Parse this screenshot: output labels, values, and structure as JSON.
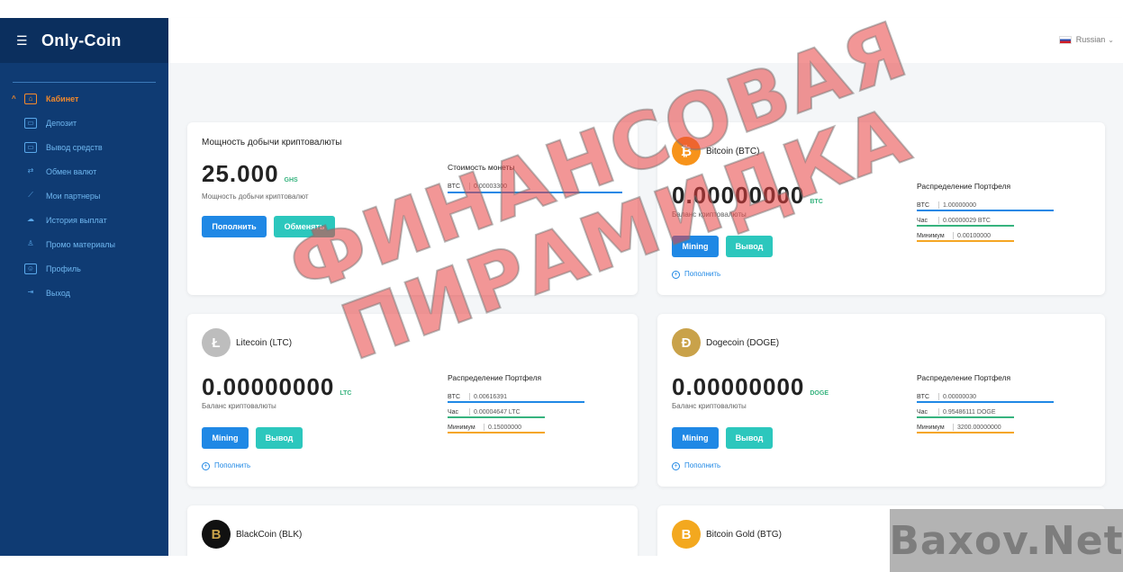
{
  "brand": {
    "menu_icon": "menu-icon",
    "name": "Only-Coin"
  },
  "header": {
    "language": "Russian"
  },
  "sidebar": {
    "items": [
      {
        "label": "Кабинет",
        "icon": "bank-icon",
        "active": true
      },
      {
        "label": "Депозит",
        "icon": "wallet-icon"
      },
      {
        "label": "Вывод средств",
        "icon": "withdraw-icon"
      },
      {
        "label": "Обмен валют",
        "icon": "exchange-icon"
      },
      {
        "label": "Мои партнеры",
        "icon": "chart-icon"
      },
      {
        "label": "История выплат",
        "icon": "history-icon"
      },
      {
        "label": "Промо материалы",
        "icon": "user-icon"
      },
      {
        "label": "Профиль",
        "icon": "profile-icon"
      },
      {
        "label": "Выход",
        "icon": "logout-icon"
      }
    ]
  },
  "power_card": {
    "title": "Мощность добычи криптовалюты",
    "value": "25.000",
    "unit": "GHS",
    "caption": "Мощность добычи криптовалют",
    "topup_label": "Пополнить",
    "exchange_label": "Обменять",
    "price_title": "Стоимость монеты",
    "price_row": {
      "k": "BTC",
      "v": "0.00003300"
    }
  },
  "btc_card": {
    "name": "Bitcoin (BTC)",
    "value": "0.00000000",
    "unit": "BTC",
    "caption": "Баланс криптовалюты",
    "mining_label": "Mining",
    "withdraw_label": "Вывод",
    "add_label": "Пополнить",
    "dist_title": "Распределение Портфеля",
    "rows": [
      {
        "k": "BTC",
        "v": "1.00000000"
      },
      {
        "k": "Час",
        "v": "0.00000029 BTC"
      },
      {
        "k": "Минимум",
        "v": "0.00100000"
      }
    ]
  },
  "ltc_card": {
    "name": "Litecoin (LTC)",
    "value": "0.00000000",
    "unit": "LTC",
    "caption": "Баланс криптовалюты",
    "mining_label": "Mining",
    "withdraw_label": "Вывод",
    "add_label": "Пополнить",
    "dist_title": "Распределение Портфеля",
    "rows": [
      {
        "k": "BTC",
        "v": "0.00616391"
      },
      {
        "k": "Час",
        "v": "0.00004647 LTC"
      },
      {
        "k": "Минимум",
        "v": "0.15000000"
      }
    ]
  },
  "doge_card": {
    "name": "Dogecoin (DOGE)",
    "value": "0.00000000",
    "unit": "DOGE",
    "caption": "Баланс криптовалюты",
    "mining_label": "Mining",
    "withdraw_label": "Вывод",
    "add_label": "Пополнить",
    "dist_title": "Распределение Портфеля",
    "rows": [
      {
        "k": "BTC",
        "v": "0.00000030"
      },
      {
        "k": "Час",
        "v": "0.95486111 DOGE"
      },
      {
        "k": "Минимум",
        "v": "3200.00000000"
      }
    ]
  },
  "blk_card": {
    "name": "BlackCoin (BLK)"
  },
  "btg_card": {
    "name": "Bitcoin Gold (BTG)"
  },
  "watermark": {
    "line1": "ФИНАНСОВАЯ",
    "line2": "ПИРАМИДКА"
  },
  "site_watermark": "Baxov.Net",
  "colors": {
    "sidebar": "#0f3b73",
    "accent": "#f58a2a",
    "blue": "#1f88e5",
    "teal": "#2cc7bd",
    "green": "#36b37e",
    "orange": "#f5a623"
  }
}
